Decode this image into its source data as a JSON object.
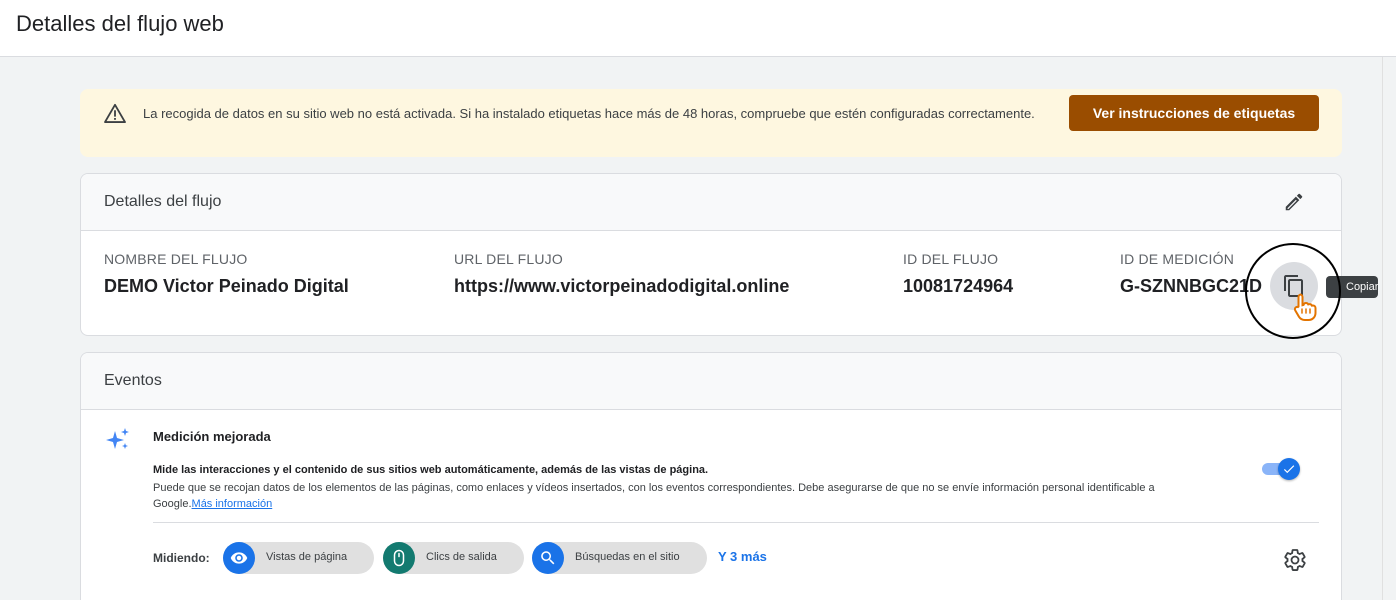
{
  "header": {
    "title": "Detalles del flujo web"
  },
  "alert": {
    "icon": "warning-icon",
    "message": "La recogida de datos en su sitio web no está activada. Si ha instalado etiquetas hace más de 48 horas, compruebe que estén configuradas correctamente.",
    "button_label": "Ver instrucciones de etiquetas",
    "background_color": "#fef7e0",
    "button_color": "#9a4d00"
  },
  "stream_details": {
    "title": "Detalles del flujo",
    "fields": [
      {
        "label": "NOMBRE DEL FLUJO",
        "value": "DEMO Victor Peinado Digital"
      },
      {
        "label": "URL DEL FLUJO",
        "value": "https://www.victorpeinadodigital.online"
      },
      {
        "label": "ID DEL FLUJO",
        "value": "10081724964"
      },
      {
        "label": "ID DE MEDICIÓN",
        "value": "G-SZNNBGC21D"
      }
    ],
    "copy_tooltip": "Copiar"
  },
  "events": {
    "title": "Eventos",
    "enhanced_measurement": {
      "title": "Medición mejorada",
      "description": "Mide las interacciones y el contenido de sus sitios web automáticamente, además de las vistas de página.",
      "subtext": "Puede que se recojan datos de los elementos de las páginas, como enlaces y vídeos insertados, con los eventos correspondientes. Debe asegurarse de que no se envíe información personal identificable a Google.",
      "link_label": "Más información",
      "enabled": true,
      "measuring_label": "Midiendo:",
      "chips": [
        {
          "label": "Vistas de página",
          "icon": "eye-icon",
          "color": "#1a73e8"
        },
        {
          "label": "Clics de salida",
          "icon": "mouse-icon",
          "color": "#137a70"
        },
        {
          "label": "Búsquedas en el sitio",
          "icon": "search-icon",
          "color": "#1a73e8"
        }
      ],
      "more_label": "Y 3 más"
    }
  }
}
